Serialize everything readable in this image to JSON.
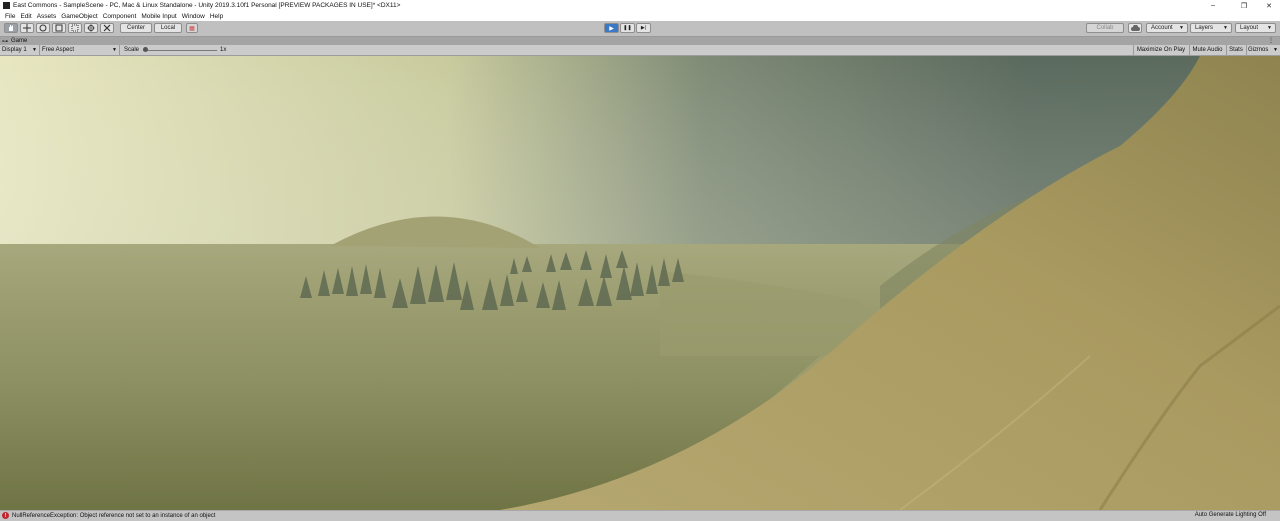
{
  "window": {
    "title": "East Commons - SampleScene - PC, Mac & Linux Standalone - Unity 2019.3.10f1 Personal [PREVIEW PACKAGES IN USE]* <DX11>",
    "controls": [
      "–",
      "❐",
      "✕"
    ]
  },
  "menu": [
    "File",
    "Edit",
    "Assets",
    "GameObject",
    "Component",
    "Mobile Input",
    "Window",
    "Help"
  ],
  "toolbar": {
    "pivot": "Center",
    "space": "Local",
    "collab": "Collab",
    "account": "Account",
    "layers": "Layers",
    "layout": "Layout",
    "play_icon": "▶",
    "pause_icon": "❚❚",
    "step_icon": "▶|"
  },
  "game_tab": {
    "label": "Game"
  },
  "game_bar": {
    "display": "Display 1",
    "aspect": "Free Aspect",
    "scale_label": "Scale",
    "scale_value": "1x",
    "maximize": "Maximize On Play",
    "mute": "Mute Audio",
    "stats": "Stats",
    "gizmos": "Gizmos"
  },
  "status": {
    "error": "NullReferenceException: Object reference not set to an instance of an object",
    "lighting": "Auto Generate Lighting Off"
  }
}
